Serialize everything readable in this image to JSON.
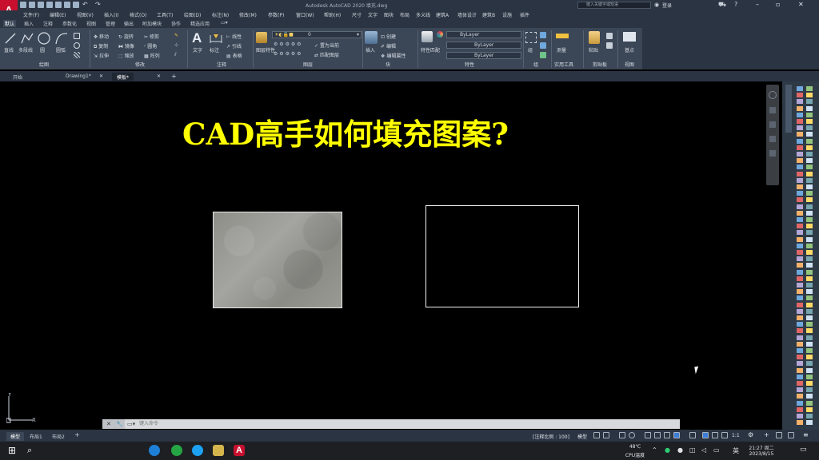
{
  "window": {
    "title": "Autodesk AutoCAD 2020   填充.dwg",
    "search_placeholder": "键入关键字或短语",
    "user": "登录",
    "app_logo": "A"
  },
  "menubar": [
    "文件(F)",
    "编辑(E)",
    "视图(V)",
    "插入(I)",
    "格式(O)",
    "工具(T)",
    "绘图(D)",
    "标注(N)",
    "修改(M)",
    "参数(P)",
    "窗口(W)",
    "帮助(H)",
    "尺寸",
    "文字",
    "图块",
    "布局",
    "多义线",
    "建筑A",
    "墙体设计",
    "建筑B",
    "设施",
    "插件"
  ],
  "ribbon_tabs": [
    "默认",
    "插入",
    "注释",
    "参数化",
    "视图",
    "管理",
    "输出",
    "附加模块",
    "协作",
    "精选应用"
  ],
  "ribbon": {
    "draw": {
      "line": "直线",
      "polyline": "多段线",
      "circle": "圆",
      "arc": "圆弧",
      "panel": "绘图"
    },
    "modify": {
      "move": "移动",
      "rotate": "旋转",
      "trim": "修剪",
      "copy": "复制",
      "mirror": "镜像",
      "fillet": "圆角",
      "stretch": "拉伸",
      "scale": "缩放",
      "array": "阵列",
      "panel": "修改"
    },
    "annotation": {
      "text": "文字",
      "dimension": "标注",
      "linear": "线性",
      "leader": "引线",
      "table": "表格",
      "panel": "注释"
    },
    "layers": {
      "layer_props": "图层特性",
      "layer_value": "0",
      "make_current": "置为当前",
      "match_layer": "匹配图层",
      "panel": "图层"
    },
    "block": {
      "insert": "插入",
      "create": "创建",
      "edit": "编辑",
      "edit_attrs": "编辑属性",
      "panel": "块"
    },
    "properties": {
      "match": "特性匹配",
      "color": "ByLayer",
      "linetype": "ByLayer",
      "lineweight": "ByLayer",
      "panel": "特性"
    },
    "groups": {
      "group": "组",
      "panel": "组"
    },
    "utilities": {
      "measure": "测量",
      "panel": "实用工具"
    },
    "clipboard": {
      "paste": "粘贴",
      "panel": "剪贴板"
    },
    "view": {
      "base": "基点",
      "panel": "视图"
    }
  },
  "doc_tabs": [
    "开始",
    "Drawing1*",
    "模板*"
  ],
  "canvas": {
    "heading": "CAD高手如何填充图案?"
  },
  "command_line": {
    "placeholder": "键入命令"
  },
  "layout_tabs": [
    "模型",
    "布局1",
    "布局2"
  ],
  "status": {
    "scale_label": "[注释比例 : 100]",
    "grid_mode": "模型",
    "zoom": "1:1"
  },
  "taskbar": {
    "weather": "48℃",
    "cpu": "CPU温度",
    "time": "21:27 周二",
    "date": "2023/8/15"
  },
  "colors": {
    "heading": "#ffff00",
    "accent": "#c8102e",
    "ribbon": "#3b4656",
    "chrome": "#2b3442"
  }
}
